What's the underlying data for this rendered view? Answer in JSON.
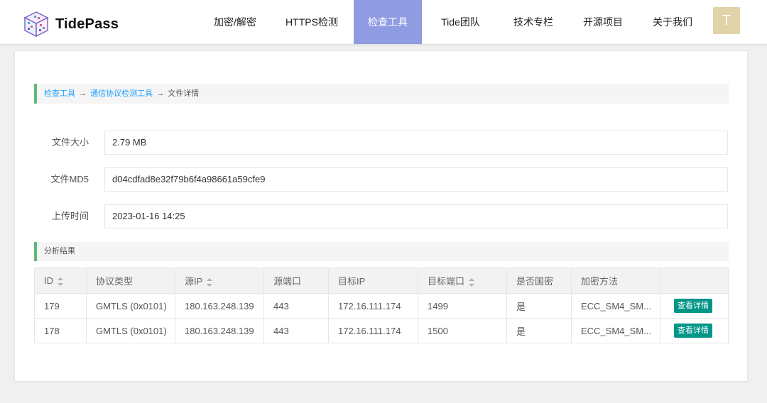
{
  "header": {
    "brand": "TidePass",
    "nav": [
      {
        "label": "加密/解密",
        "active": false
      },
      {
        "label": "HTTPS检测",
        "active": false
      },
      {
        "label": "检查工具",
        "active": true
      },
      {
        "label": "Tide团队",
        "active": false
      },
      {
        "label": "技术专栏",
        "active": false
      },
      {
        "label": "开源项目",
        "active": false
      },
      {
        "label": "关于我们",
        "active": false
      }
    ],
    "avatar_letter": "T"
  },
  "breadcrumb": {
    "item1": "检查工具",
    "item2": "通信协议检测工具",
    "item3": "文件详情",
    "sep": "→"
  },
  "fields": {
    "size_label": "文件大小",
    "size_value": "2.79 MB",
    "md5_label": "文件MD5",
    "md5_value": "d04cdfad8e32f79b6f4a98661a59cfe9",
    "time_label": "上传时间",
    "time_value": "2023-01-16 14:25"
  },
  "results": {
    "title": "分析结果",
    "columns": [
      "ID",
      "协议类型",
      "源IP",
      "源端口",
      "目标IP",
      "目标端口",
      "是否国密",
      "加密方法",
      ""
    ],
    "rows": [
      {
        "id": "179",
        "protocol": "GMTLS (0x0101)",
        "src_ip": "180.163.248.139",
        "src_port": "443",
        "dst_ip": "172.16.111.174",
        "dst_port": "1499",
        "gm": "是",
        "cipher": "ECC_SM4_SM...",
        "action": "查看详情"
      },
      {
        "id": "178",
        "protocol": "GMTLS (0x0101)",
        "src_ip": "180.163.248.139",
        "src_port": "443",
        "dst_ip": "172.16.111.174",
        "dst_port": "1500",
        "gm": "是",
        "cipher": "ECC_SM4_SM...",
        "action": "查看详情"
      }
    ]
  },
  "colors": {
    "nav_active": "#8f9ce2",
    "accent_bar": "#5fb878",
    "link": "#1e9fff",
    "button": "#009688",
    "avatar": "#e0d3a7"
  },
  "icons": {
    "logo": "cube-logo-icon",
    "sort": "sort-icon"
  }
}
